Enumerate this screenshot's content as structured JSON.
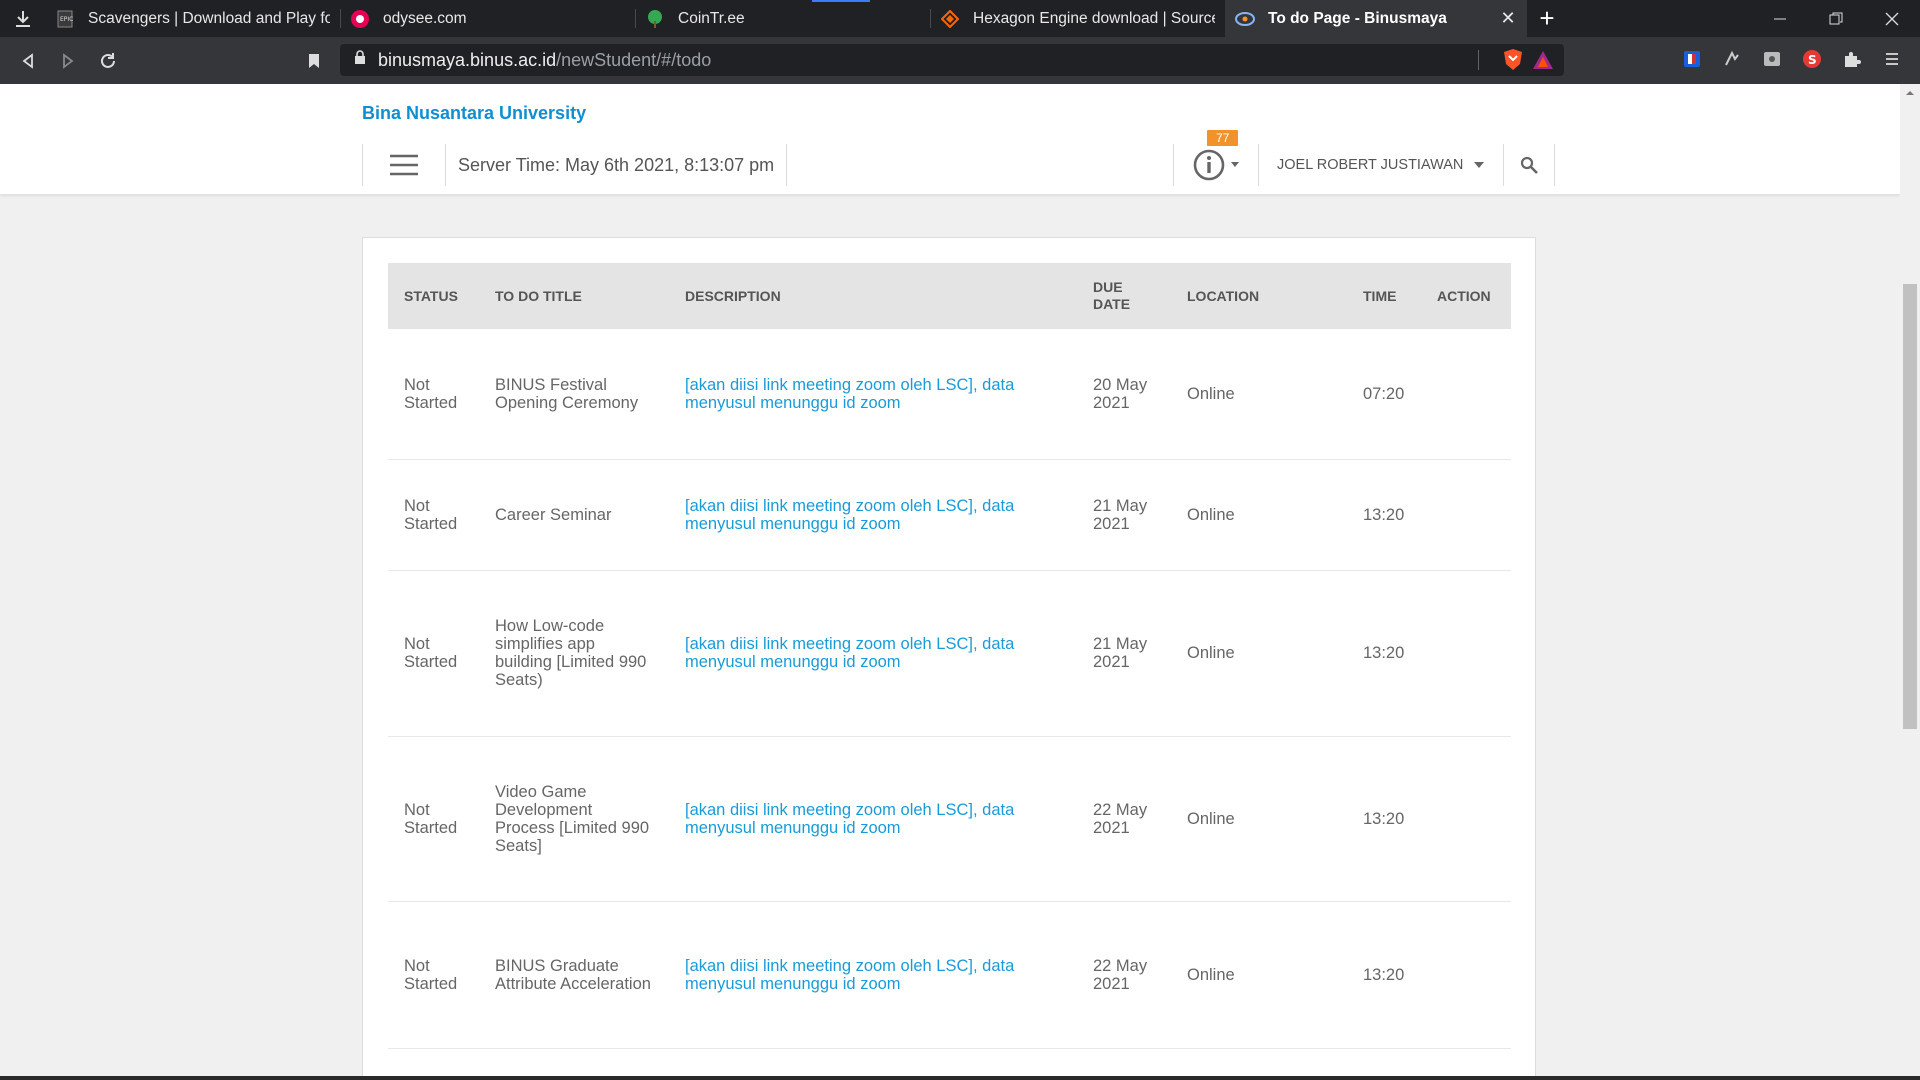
{
  "browser": {
    "tabs": [
      {
        "title": "Scavengers | Download and Play for Fr",
        "icon": "epic-games-icon"
      },
      {
        "title": "odysee.com",
        "icon": "odysee-icon"
      },
      {
        "title": "CoinTr.ee",
        "icon": "tree-icon"
      },
      {
        "title": "Hexagon Engine download | SourceFo",
        "icon": "sourceforge-icon"
      },
      {
        "title": "To do Page - Binusmaya",
        "icon": "binus-icon",
        "active": true
      }
    ],
    "address": {
      "host": "binusmaya.binus.ac.id",
      "path": "/newStudent/#/todo"
    },
    "accent_color": "#3e7bfa"
  },
  "header": {
    "brand": "Bina Nusantara University",
    "brand_color": "#0f8fd1",
    "server_time": "Server Time: May 6th 2021, 8:13:07 pm",
    "notification_count": "77",
    "badge_color": "#f2922a",
    "user_name": "JOEL ROBERT JUSTIAWAN"
  },
  "todo_table": {
    "columns": {
      "status": "STATUS",
      "title": "TO DO TITLE",
      "description": "DESCRIPTION",
      "due_date_1": "DUE",
      "due_date_2": "DATE",
      "location": "LOCATION",
      "time": "TIME",
      "action": "ACTION"
    },
    "rows": [
      {
        "status": "Not Started",
        "title": "BINUS Festival Opening Ceremony",
        "description": "[akan diisi link meeting zoom oleh LSC], data menyusul menunggu id zoom",
        "due": "20 May 2021",
        "location": "Online",
        "time": "07:20",
        "action": ""
      },
      {
        "status": "Not Started",
        "title": "Career Seminar",
        "description": "[akan diisi link meeting zoom oleh LSC], data menyusul menunggu id zoom",
        "due": "21 May 2021",
        "location": "Online",
        "time": "13:20",
        "action": ""
      },
      {
        "status": "Not Started",
        "title": "How Low-code simplifies app building [Limited 990 Seats)",
        "description": "[akan diisi link meeting zoom oleh LSC], data menyusul menunggu id zoom",
        "due": "21 May 2021",
        "location": "Online",
        "time": "13:20",
        "action": ""
      },
      {
        "status": "Not Started",
        "title": "Video Game Development Process [Limited 990 Seats]",
        "description": "[akan diisi link meeting zoom oleh LSC], data menyusul menunggu id zoom",
        "due": "22 May 2021",
        "location": "Online",
        "time": "13:20",
        "action": ""
      },
      {
        "status": "Not Started",
        "title": "BINUS Graduate Attribute Acceleration",
        "description": "[akan diisi link meeting zoom oleh LSC], data menyusul menunggu id zoom",
        "due": "22 May 2021",
        "location": "Online",
        "time": "13:20",
        "action": ""
      }
    ]
  }
}
